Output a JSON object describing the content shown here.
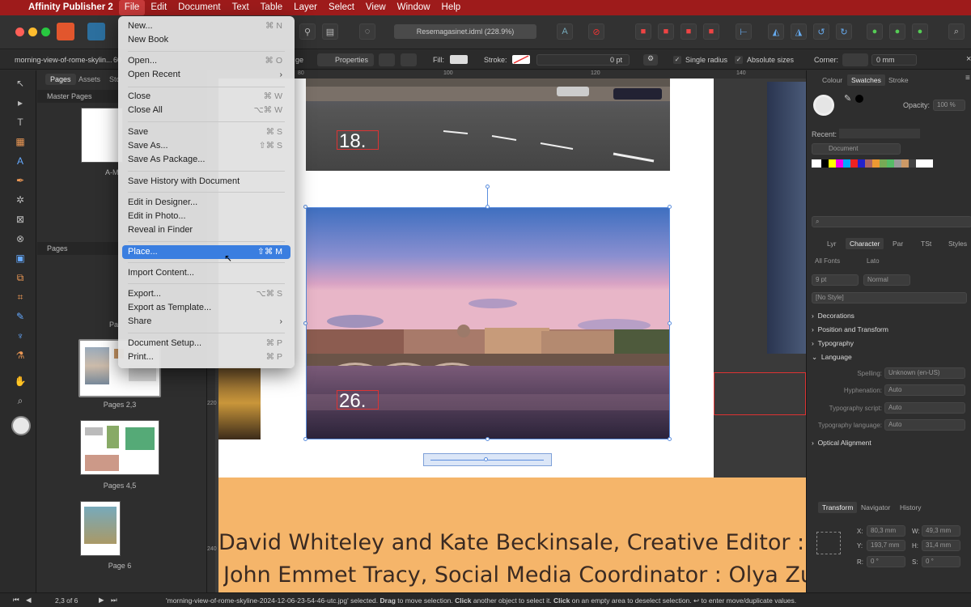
{
  "menubar": {
    "app": "Affinity Publisher 2",
    "items": [
      "File",
      "Edit",
      "Document",
      "Text",
      "Table",
      "Layer",
      "Select",
      "View",
      "Window",
      "Help"
    ]
  },
  "toolbar": {
    "doc_title": "Resemagasinet.idml (228.9%)"
  },
  "context": {
    "file_label": "morning-view-of-rome-skylin...",
    "zoom_snip": "60",
    "image_snip": "ge",
    "properties": "Properties",
    "fill": "Fill:",
    "stroke": "Stroke:",
    "stroke_value": "0 pt",
    "single_radius": "Single radius",
    "absolute_sizes": "Absolute sizes",
    "corner": "Corner:",
    "corner_value": "0 mm"
  },
  "pages_panel": {
    "tabs": [
      "Pages",
      "Assets",
      "Sto"
    ],
    "master_section": "Master Pages",
    "master_caption": "A-M",
    "pages_section": "Pages",
    "page_snip": "Pa",
    "captions": [
      "Pages 2,3",
      "Pages 4,5",
      "Page 6"
    ]
  },
  "file_menu": {
    "items": [
      {
        "label": "New...",
        "shortcut": "⌘ N"
      },
      {
        "label": "New Book",
        "shortcut": ""
      },
      {
        "label": "Open...",
        "shortcut": "⌘ O"
      },
      {
        "label": "Open Recent",
        "shortcut": "›"
      },
      {
        "label": "Close",
        "shortcut": "⌘ W"
      },
      {
        "label": "Close All",
        "shortcut": "⌥⌘ W"
      },
      {
        "label": "Save",
        "shortcut": "⌘ S"
      },
      {
        "label": "Save As...",
        "shortcut": "⇧⌘ S"
      },
      {
        "label": "Save As Package...",
        "shortcut": ""
      },
      {
        "label": "Save History with Document",
        "shortcut": ""
      },
      {
        "label": "Edit in Designer...",
        "shortcut": ""
      },
      {
        "label": "Edit in Photo...",
        "shortcut": ""
      },
      {
        "label": "Reveal in Finder",
        "shortcut": ""
      },
      {
        "label": "Place...",
        "shortcut": "⇧⌘ M"
      },
      {
        "label": "Import Content...",
        "shortcut": ""
      },
      {
        "label": "Export...",
        "shortcut": "⌥⌘ S"
      },
      {
        "label": "Export as Template...",
        "shortcut": ""
      },
      {
        "label": "Share",
        "shortcut": "›"
      },
      {
        "label": "Document Setup...",
        "shortcut": "⌘ P"
      },
      {
        "label": "Print...",
        "shortcut": "⌘ P"
      }
    ]
  },
  "canvas": {
    "num1": "18.",
    "num2": "26.",
    "credit1": "David Whiteley and Kate Beckinsale, Creative Editor : Jon",
    "credit2": "John Emmet Tracy, Social Media Coordinator : Olya Zuev",
    "ruler_marks": [
      "80",
      "100",
      "120",
      "140"
    ],
    "ruler_left": [
      "220",
      "240"
    ]
  },
  "right_panel": {
    "tabs1": [
      "Colour",
      "Swatches",
      "Stroke"
    ],
    "opacity_label": "Opacity:",
    "opacity_value": "100 %",
    "recent": "Recent:",
    "palette": "Document",
    "tabs2": [
      "Lyr",
      "Character",
      "Par",
      "TSt",
      "Styles"
    ],
    "font_collection": "All Fonts",
    "font": "Lato",
    "size": "9 pt",
    "weight": "Normal",
    "style": "[No Style]",
    "sections": [
      "Decorations",
      "Position and Transform",
      "Typography",
      "Language"
    ],
    "language_rows": [
      {
        "k": "Spelling:",
        "v": "Unknown (en-US)"
      },
      {
        "k": "Hyphenation:",
        "v": "Auto"
      },
      {
        "k": "Typography script:",
        "v": "Auto"
      },
      {
        "k": "Typography language:",
        "v": "Auto"
      }
    ],
    "optical": "Optical Alignment",
    "tabs3": [
      "Transform",
      "Navigator",
      "History"
    ],
    "transform": {
      "x_label": "X:",
      "x": "80,3 mm",
      "w_label": "W:",
      "w": "49,3 mm",
      "y_label": "Y:",
      "y": "193,7 mm",
      "h_label": "H:",
      "h": "31,4 mm",
      "r_label": "R:",
      "r": "0 °",
      "s_label": "S:",
      "s": "0 °"
    }
  },
  "status": {
    "page": "2,3 of 6",
    "message_pre": "'morning-view-of-rome-skyline-2024-12-06-23-54-46-utc.jpg' selected. ",
    "drag": "Drag",
    "msg2": " to move selection. ",
    "click": "Click",
    "msg3": " another object to select it. ",
    "click2": "Click",
    "msg4": " on an empty area to deselect selection. ",
    "msg5": "↩ to enter move/duplicate values."
  },
  "colors": {
    "menubar": "#9e1b1b",
    "accent": "#3a7ee0",
    "orange": "#f5b56a"
  }
}
